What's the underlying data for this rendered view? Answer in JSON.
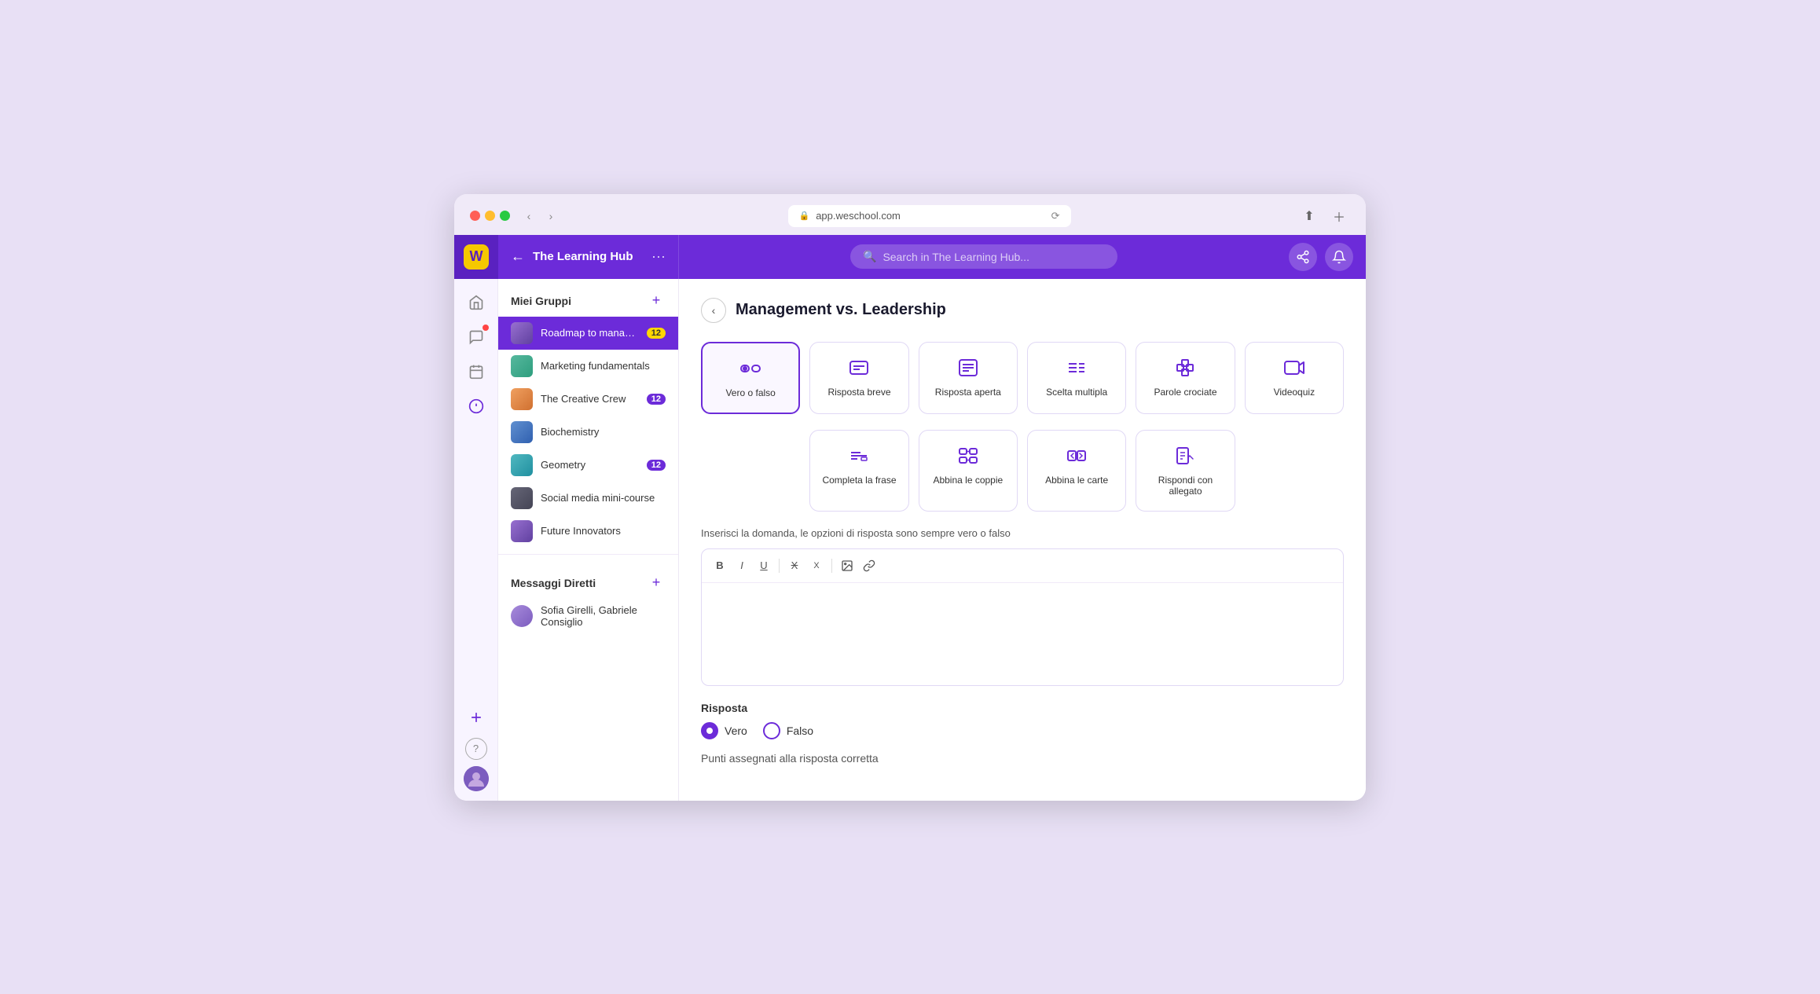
{
  "browser": {
    "url": "app.weschool.com",
    "refresh_icon": "⟳"
  },
  "header": {
    "workspace_name": "The Learning Hub",
    "back_icon": "←",
    "more_icon": "···",
    "search_placeholder": "Search in The Learning Hub...",
    "logo_letter": "W"
  },
  "sidebar_icons": {
    "home_icon": "⌂",
    "chat_icon": "💬",
    "calendar_icon": "📅",
    "draw_icon": "✏",
    "add_icon": "+"
  },
  "left_panel": {
    "groups_section_title": "Miei Gruppi",
    "add_btn": "+",
    "groups": [
      {
        "name": "Roadmap to management",
        "badge": "12",
        "badge_type": "yellow",
        "color": "purple2",
        "active": true
      },
      {
        "name": "Marketing fundamentals",
        "badge": "",
        "badge_type": "",
        "color": "green"
      },
      {
        "name": "The Creative Crew",
        "badge": "12",
        "badge_type": "purple",
        "color": "orange"
      },
      {
        "name": "Biochemistry",
        "badge": "",
        "badge_type": "",
        "color": "blue"
      },
      {
        "name": "Geometry",
        "badge": "12",
        "badge_type": "purple",
        "color": "teal"
      },
      {
        "name": "Social media mini-course",
        "badge": "",
        "badge_type": "",
        "color": "dark"
      },
      {
        "name": "Future Innovators",
        "badge": "",
        "badge_type": "",
        "color": "purple2"
      }
    ],
    "dm_section_title": "Messaggi Diretti",
    "dm_add_btn": "+",
    "dm_items": [
      {
        "name": "Sofia Girelli, Gabriele Consiglio"
      }
    ]
  },
  "content": {
    "back_btn": "‹",
    "title": "Management vs. Leadership",
    "question_types": [
      {
        "id": "vero-falso",
        "label": "Vero o falso",
        "active": true
      },
      {
        "id": "risposta-breve",
        "label": "Risposta breve",
        "active": false
      },
      {
        "id": "risposta-aperta",
        "label": "Risposta aperta",
        "active": false
      },
      {
        "id": "scelta-multipla",
        "label": "Scelta multipla",
        "active": false
      },
      {
        "id": "parole-crociate",
        "label": "Parole crociate",
        "active": false
      },
      {
        "id": "videoquiz",
        "label": "Videoquiz",
        "active": false
      }
    ],
    "question_types_row2": [
      {
        "id": "completa-frase",
        "label": "Completa la frase",
        "active": false
      },
      {
        "id": "abbina-coppie",
        "label": "Abbina le coppie",
        "active": false
      },
      {
        "id": "abbina-carte",
        "label": "Abbina le carte",
        "active": false
      },
      {
        "id": "rispondi-allegato",
        "label": "Rispondi con allegato",
        "active": false
      }
    ],
    "instruction_text": "Inserisci la domanda, le opzioni di risposta sono sempre vero o falso",
    "editor_toolbar": {
      "bold": "B",
      "italic": "I",
      "underline": "U",
      "strikethrough1": "X",
      "strikethrough2": "X",
      "image": "🖼",
      "link": "🔗"
    },
    "answer_section": {
      "label": "Risposta",
      "options": [
        {
          "id": "vero",
          "label": "Vero",
          "selected": true
        },
        {
          "id": "falso",
          "label": "Falso",
          "selected": false
        }
      ]
    },
    "points_label": "Punti assegnati alla risposta corretta"
  }
}
